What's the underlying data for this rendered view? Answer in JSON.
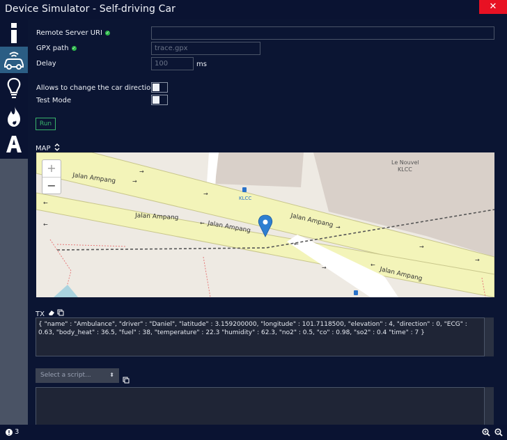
{
  "window": {
    "title": "Device Simulator - Self-driving Car",
    "close_glyph": "✕"
  },
  "sidebar": {
    "items": [
      {
        "icon": "info-icon",
        "active": false
      },
      {
        "icon": "car-signal-icon",
        "active": true
      },
      {
        "icon": "lightbulb-icon",
        "active": false
      },
      {
        "icon": "flame-icon",
        "active": false
      },
      {
        "icon": "letter-a-icon",
        "active": false
      }
    ]
  },
  "form": {
    "remote_server_label": "Remote Server URI",
    "remote_server_value": "",
    "gpx_label": "GPX path",
    "gpx_value": "trace.gpx",
    "delay_label": "Delay",
    "delay_value": "100",
    "delay_unit": "ms",
    "direction_label": "Allows to change the car direction",
    "test_mode_label": "Test Mode",
    "run_label": "Run"
  },
  "map": {
    "section_label": "MAP",
    "zoom_in": "+",
    "zoom_out": "−",
    "labels": {
      "street1": "Jalan Ampang",
      "poi_name_1": "Le Nouvel",
      "poi_name_2": "KLCC",
      "station": "KLCC"
    }
  },
  "tx": {
    "label": "TX",
    "payload": "{ \"name\" : \"Ambulance\", \"driver\" : \"Daniel\", \"latitude\" : 3.159200000, \"longitude\" : 101.7118500, \"elevation\" : 4, \"direction\" : 0, \"ECG\" : 0.63, \"body_heat\" : 36.5, \"fuel\" : 38, \"temperature\" : 22.3 \"humidity\" : 62.3, \"no2\" : 0.5, \"co\" : 0.98, \"so2\" : 0.4 \"time\" : 7 }"
  },
  "script": {
    "placeholder": "Select a script..."
  },
  "status": {
    "warning_count": "3"
  },
  "colors": {
    "accent": "#2b5d84",
    "run_green": "#39b46b",
    "close_red": "#e81123",
    "road_yellow": "#f3f4b9"
  }
}
